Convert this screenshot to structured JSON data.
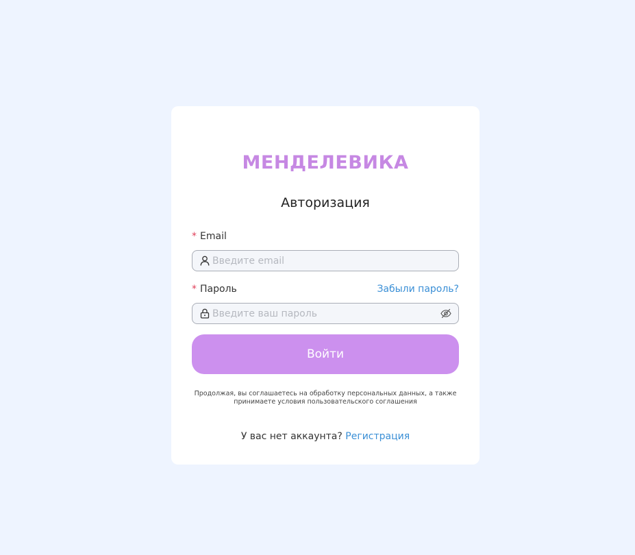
{
  "brand": {
    "logo": "МЕНДЕЛЕВИКА",
    "accent_color": "#c688e3"
  },
  "form": {
    "title": "Авторизация",
    "required_mark": "*",
    "email": {
      "label": "Email",
      "placeholder": "Введите email",
      "value": "",
      "icon": "user-icon"
    },
    "password": {
      "label": "Пароль",
      "placeholder": "Введите ваш пароль",
      "value": "",
      "icon": "lock-icon",
      "toggle_icon": "eye-off-icon",
      "forgot_link": "Забыли пароль?"
    },
    "submit_label": "Войти",
    "submit_color": "#cc90ee",
    "consent_text": "Продолжая, вы соглашаетесь на обработку персональных данных, а также принимаете условия пользовательского соглашения"
  },
  "footer": {
    "no_account_text": "У вас нет аккаунта?",
    "register_link": "Регистрация",
    "link_color": "#3a8fd6"
  }
}
